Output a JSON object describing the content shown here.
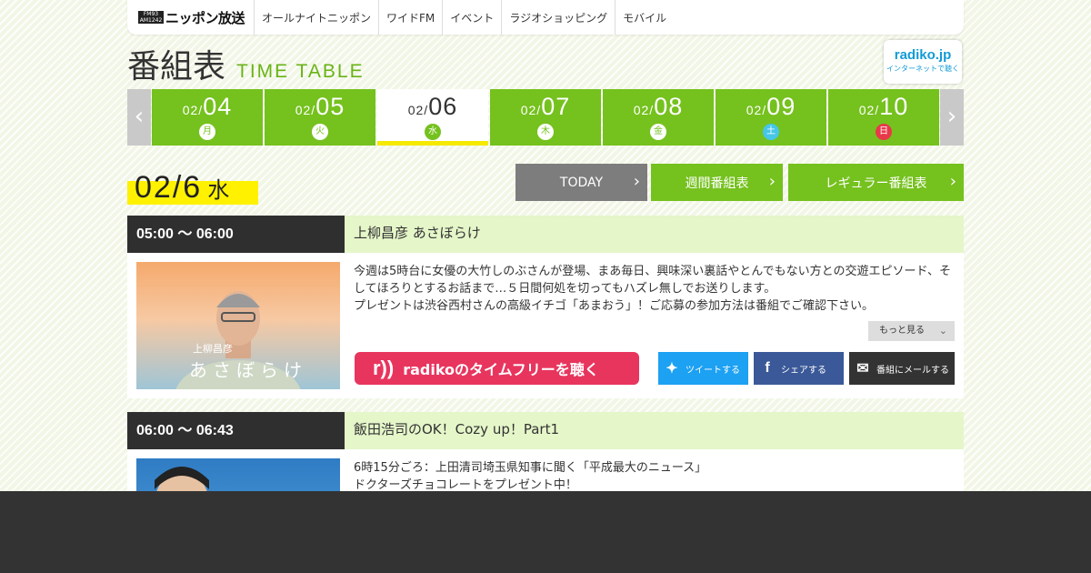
{
  "nav": {
    "logo_badge": "FM93 AM1242",
    "logo_text": "ニッポン放送",
    "items": [
      "オールナイトニッポン",
      "ワイドFM",
      "イベント",
      "ラジオショッピング",
      "モバイル"
    ]
  },
  "header": {
    "title": "番組表",
    "subtitle": "TIME TABLE",
    "radiko_name": "radiko.jp",
    "radiko_sub": "インターネットで聴く"
  },
  "days": [
    {
      "month": "02/",
      "day": "04",
      "dow": "月"
    },
    {
      "month": "02/",
      "day": "05",
      "dow": "火"
    },
    {
      "month": "02/",
      "day": "06",
      "dow": "水"
    },
    {
      "month": "02/",
      "day": "07",
      "dow": "木"
    },
    {
      "month": "02/",
      "day": "08",
      "dow": "金"
    },
    {
      "month": "02/",
      "day": "09",
      "dow": "土"
    },
    {
      "month": "02/",
      "day": "10",
      "dow": "日"
    }
  ],
  "current": {
    "date": "02/6",
    "dow": "水"
  },
  "buttons": {
    "today": "TODAY",
    "weekly": "週間番組表",
    "regular": "レギュラー番組表"
  },
  "programs": [
    {
      "time": "05:00 ～ 06:00",
      "title": "上柳昌彦 あさぼらけ",
      "desc": [
        "今週は5時台に女優の大竹しのぶさんが登場、まあ毎日、興味深い裏話やとんでもない方との交遊エピソード、そしてほろりとするお話まで…５日間何処を切ってもハズレ無しでお送りします。",
        "プレゼントは渋谷西村さんの高級イチゴ「あまおう」！ご応募の参加方法は番組でご確認下さい。"
      ],
      "thumb_name": "上柳昌彦",
      "thumb_title": "あさぼらけ",
      "more": "もっと見る",
      "radiko": "radikoのタイムフリーを聴く",
      "tweet": "ツイートする",
      "share": "シェアする",
      "mail": "番組にメールする"
    },
    {
      "time": "06:00 ～ 06:43",
      "title": "飯田浩司のOK！Cozy up！Part1",
      "desc": [
        "6時15分ごろ：上田清司埼玉県知事に聞く「平成最大のニュース」",
        "ドクターズチョコレートをプレゼント中！"
      ]
    }
  ],
  "colors": {
    "green": "#75c11e",
    "yellow": "#fff100",
    "dark": "#2f2f2f",
    "pink": "#e8355e",
    "twitter": "#1da1f2",
    "facebook": "#3b5998"
  }
}
